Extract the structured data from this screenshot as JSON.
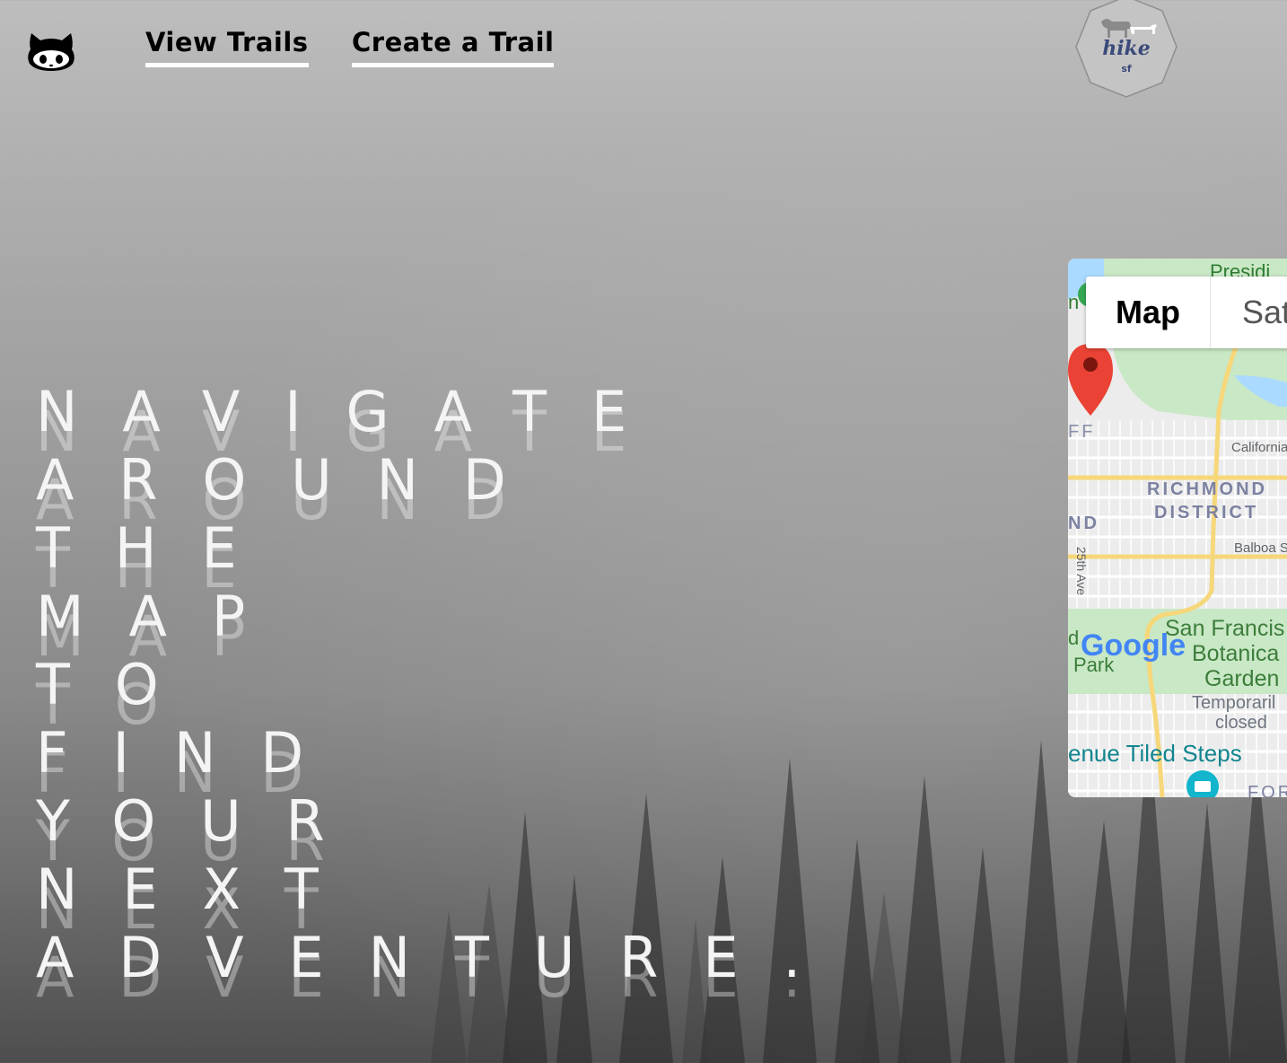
{
  "nav": {
    "github_icon": "github-octocat-icon",
    "view_trails": "View Trails",
    "create_trail": "Create a Trail"
  },
  "logo": {
    "title": "hike",
    "subtitle": "sf"
  },
  "hero": {
    "lines": [
      "NAVIGATE",
      "AROUND",
      "THE",
      "MAP",
      "TO",
      "FIND",
      "YOUR",
      "NEXT",
      "ADVENTURE."
    ]
  },
  "map": {
    "toggle_map": "Map",
    "toggle_satellite": "Sat",
    "labels": {
      "presidio": "Presidi",
      "california": "California",
      "richmond": "RICHMOND",
      "district": "DISTRICT",
      "nd": "ND",
      "ff": "FF",
      "balboa": "Balboa S",
      "ave25": "25th Ave",
      "sanfran": "San Francis",
      "botanical": "Botanica",
      "garden": "Garden",
      "temporarily": "Temporaril",
      "closed": "closed",
      "park": "Park",
      "d": "d",
      "tiled": "enue Tiled Steps",
      "for": "FOR",
      "n": "n",
      "google": "Google"
    },
    "colors": {
      "park": "#c9e8c5",
      "street": "#ffffff",
      "highway": "#f6d77a",
      "water": "#aadaff",
      "pin": "#ea4335"
    }
  }
}
